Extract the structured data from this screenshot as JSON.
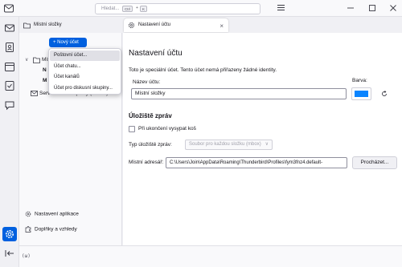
{
  "titlebar": {
    "search_placeholder": "Hledat...",
    "shortcut_key1": "Ctrl",
    "shortcut_plus": "+",
    "shortcut_key2": "K"
  },
  "spaces": [
    "mail-icon",
    "address-book-icon",
    "calendar-icon",
    "tasks-icon",
    "chat-icon",
    "settings-icon"
  ],
  "tabs": [
    {
      "label": "Místní složky"
    },
    {
      "label": "Nastavení účtu"
    }
  ],
  "left_pane": {
    "new_account_label": "+ Nový účet",
    "tree_local": "Místní složky",
    "tree_n": "N",
    "tree_m": "M",
    "tree_smtp": "Server odchozí pošty (SMTP)",
    "app_settings_label": "Nastavení aplikace",
    "addons_label": "Doplňky a vzhledy"
  },
  "dropdown": {
    "items": [
      "Poštovní účet...",
      "Účet chatu...",
      "Účet kanálů",
      "Účet pro diskusní skupiny..."
    ]
  },
  "main": {
    "heading": "Nastavení účtu",
    "info": "Toto je speciální účet. Tento účet nemá přiřazeny žádné identity.",
    "name_label": "Název účtu:",
    "name_value": "Místní složky",
    "color_label": "Barva:",
    "color_value": "#0a84ff",
    "section_title": "Úložiště zpráv",
    "empty_trash_label": "Při ukončení vysypat koš",
    "storage_type_label": "Typ úložiště zpráv:",
    "storage_type_value": "Soubor pro každou složku (mbox)",
    "local_dir_label": "Místní adresář:",
    "local_dir_value": "C:\\Users\\Join\\AppData\\Roaming\\Thunderbird\\Profiles\\fym3fnz4.default-",
    "browse_label": "Procházet..."
  },
  "statusbar": {
    "activity_icon": "(ω)"
  }
}
